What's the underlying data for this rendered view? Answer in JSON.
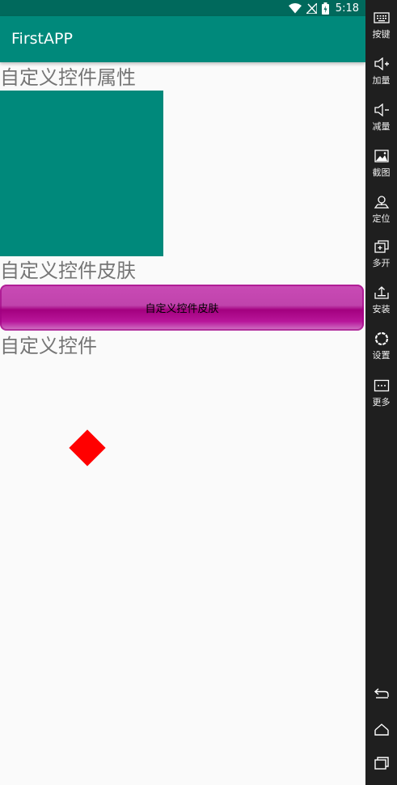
{
  "status_bar": {
    "time": "5:18",
    "icons": [
      "wifi-icon",
      "no-signal-icon",
      "battery-icon"
    ]
  },
  "app_bar": {
    "title": "FirstAPP"
  },
  "content": {
    "section1_label": "自定义控件属性",
    "section2_label": "自定义控件皮肤",
    "skin_button_label": "自定义控件皮肤",
    "section3_label": "自定义控件"
  },
  "side_toolbar": {
    "items": [
      {
        "icon": "keyboard-icon",
        "label": "按键"
      },
      {
        "icon": "volume-up-icon",
        "label": "加量"
      },
      {
        "icon": "volume-down-icon",
        "label": "减量"
      },
      {
        "icon": "screenshot-icon",
        "label": "截图"
      },
      {
        "icon": "location-icon",
        "label": "定位"
      },
      {
        "icon": "multi-open-icon",
        "label": "多开"
      },
      {
        "icon": "install-icon",
        "label": "安装"
      },
      {
        "icon": "settings-icon",
        "label": "设置"
      },
      {
        "icon": "more-icon",
        "label": "更多"
      }
    ],
    "nav": [
      "back-icon",
      "home-icon",
      "recents-icon"
    ]
  },
  "colors": {
    "status_bar": "#00695c",
    "app_bar": "#00897b",
    "teal_square": "#00897b",
    "skin_button": "#c043ac",
    "diamond": "#ff0000",
    "side_toolbar": "#1f1f1f"
  }
}
